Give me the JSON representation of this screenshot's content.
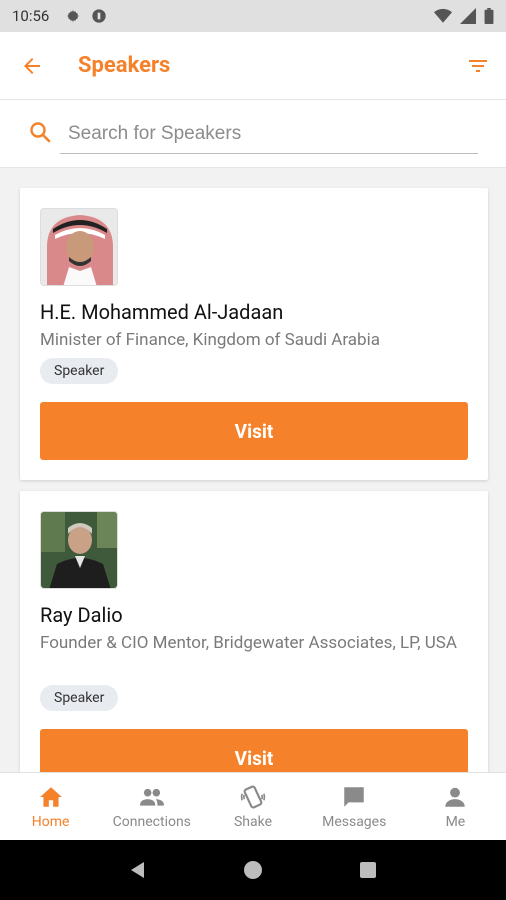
{
  "status_bar": {
    "time": "10:56"
  },
  "app_bar": {
    "title": "Speakers"
  },
  "search": {
    "placeholder": "Search for Speakers",
    "value": ""
  },
  "speakers": [
    {
      "name": "H.E. Mohammed Al-Jadaan",
      "role": "Minister of Finance, Kingdom of Saudi Arabia",
      "tag": "Speaker",
      "button": "Visit"
    },
    {
      "name": "Ray Dalio",
      "role": "Founder & CIO Mentor, Bridgewater Associates, LP, USA",
      "tag": "Speaker",
      "button": "Visit"
    }
  ],
  "bottom_nav": {
    "items": [
      {
        "label": "Home",
        "icon": "home-icon",
        "active": true
      },
      {
        "label": "Connections",
        "icon": "people-icon",
        "active": false
      },
      {
        "label": "Shake",
        "icon": "shake-icon",
        "active": false
      },
      {
        "label": "Messages",
        "icon": "chat-icon",
        "active": false
      },
      {
        "label": "Me",
        "icon": "person-icon",
        "active": false
      }
    ]
  },
  "colors": {
    "accent": "#f5812a",
    "tag_bg": "#e8ebef"
  }
}
